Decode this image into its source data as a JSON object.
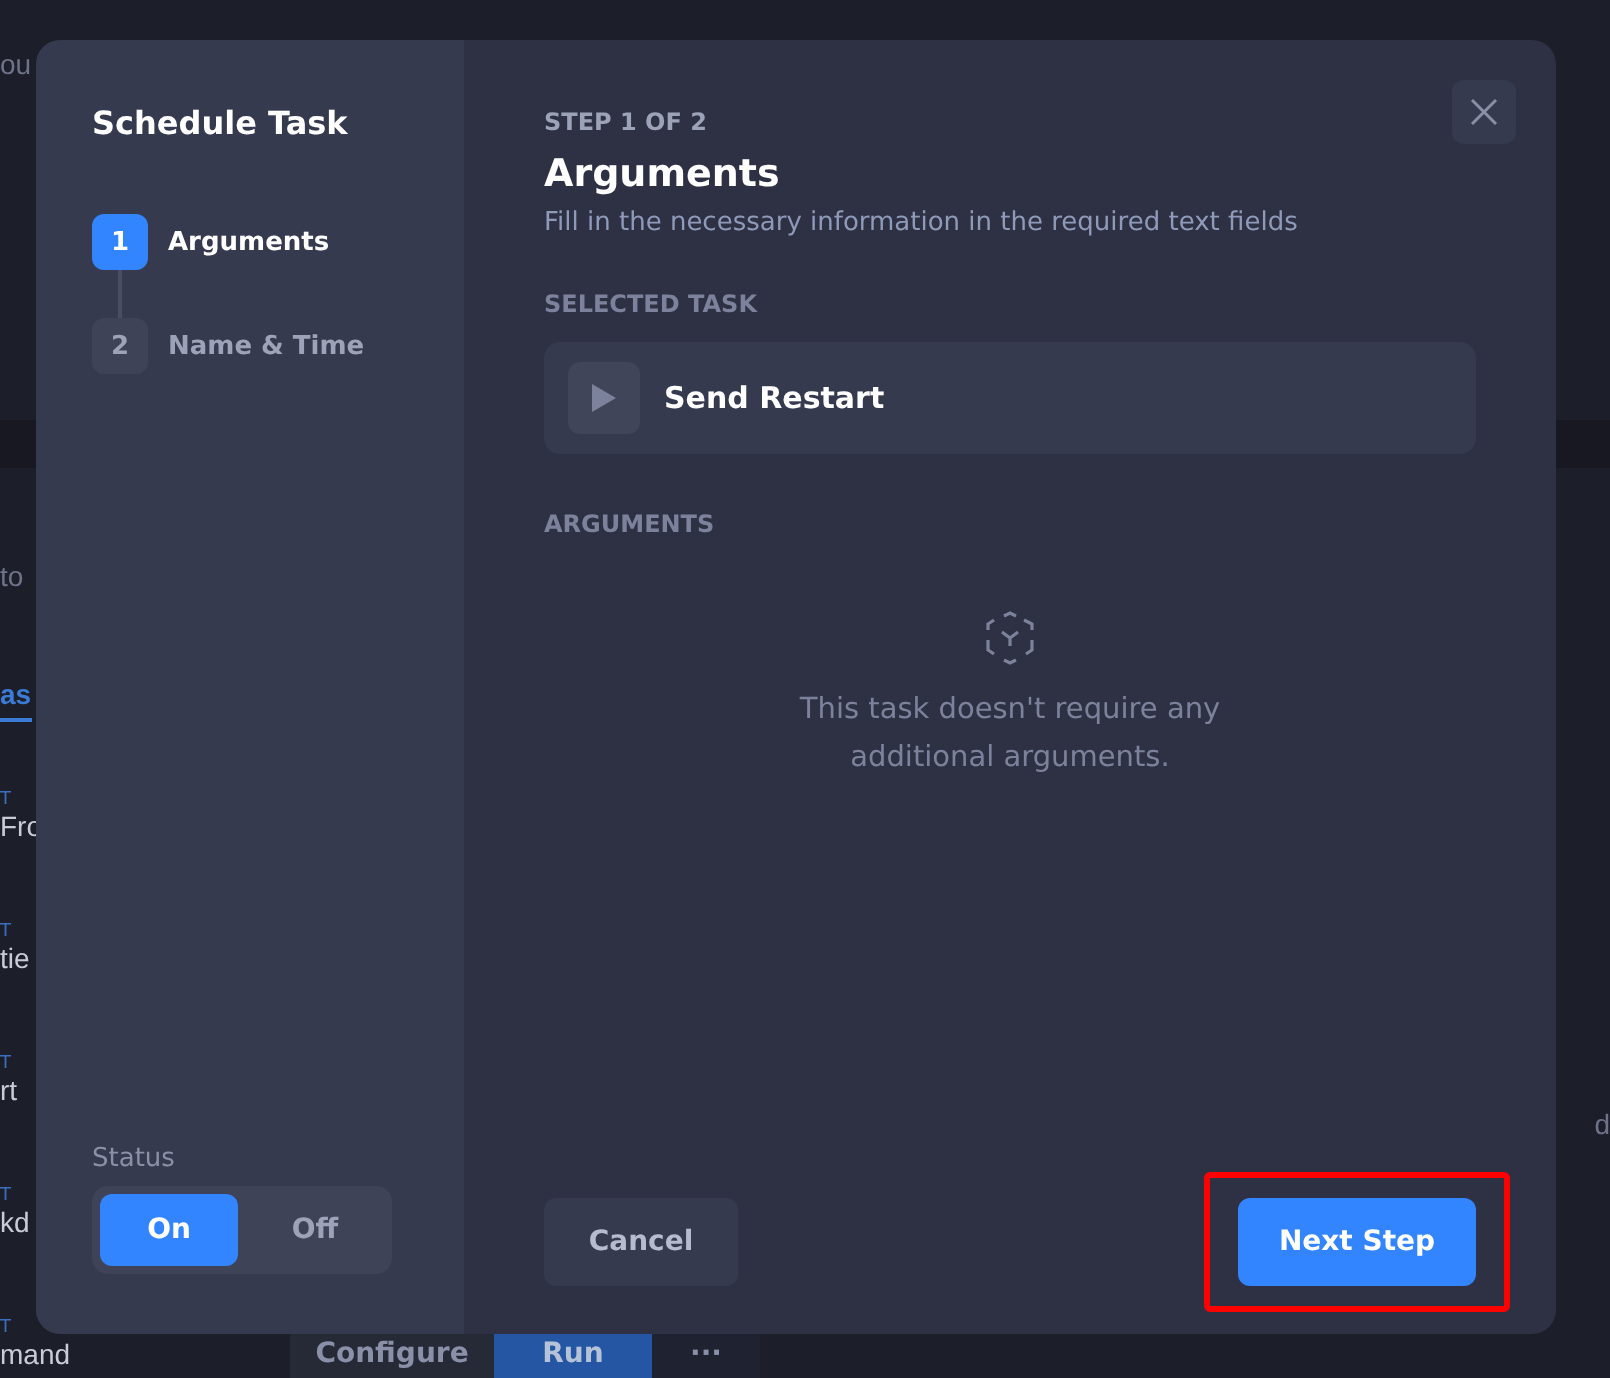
{
  "background": {
    "top_text": "ou",
    "hint_text": "to",
    "tab": "as",
    "rows": [
      {
        "tag": "T",
        "name": "Fro"
      },
      {
        "tag": "T",
        "name": "tie"
      },
      {
        "tag": "T",
        "name": "rt"
      },
      {
        "tag": "T",
        "name": "kd"
      },
      {
        "tag": "T",
        "name": "mand"
      }
    ],
    "right_text": "d",
    "buttons": [
      {
        "label": "Configure",
        "kind": "plain"
      },
      {
        "label": "Run",
        "kind": "primary"
      },
      {
        "label": "···",
        "kind": "more"
      }
    ]
  },
  "dialog": {
    "title": "Schedule Task",
    "steps": [
      {
        "number": "1",
        "label": "Arguments",
        "selected": true
      },
      {
        "number": "2",
        "label": "Name & Time",
        "selected": false
      }
    ],
    "status": {
      "label": "Status",
      "options": [
        {
          "label": "On",
          "selected": true
        },
        {
          "label": "Off",
          "selected": false
        }
      ]
    },
    "step_counter": "STEP 1 OF 2",
    "heading": "Arguments",
    "description": "Fill in the necessary information in the required text fields",
    "selected_task_label": "SELECTED TASK",
    "selected_task": "Send Restart",
    "arguments_label": "ARGUMENTS",
    "empty_message": "This task doesn't require any additional arguments.",
    "buttons": [
      {
        "label": "Cancel",
        "kind": "secondary",
        "highlighted": false
      },
      {
        "label": "Next Step",
        "kind": "primary",
        "highlighted": true
      }
    ]
  }
}
